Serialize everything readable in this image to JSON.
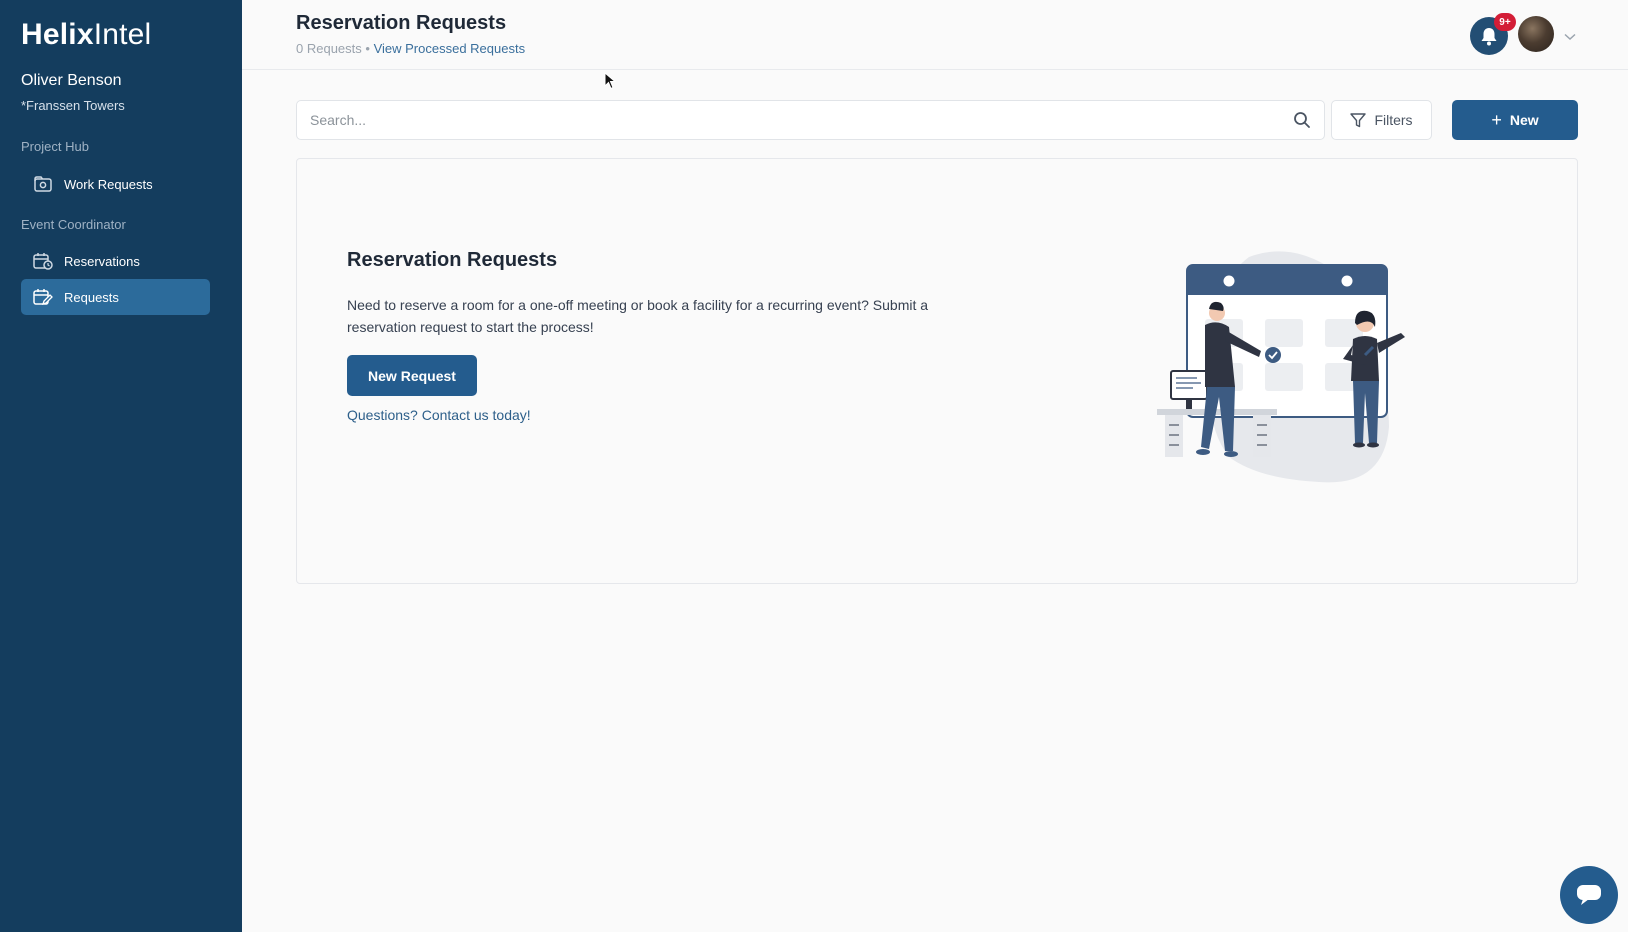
{
  "brand": {
    "bold": "Helix",
    "light": "Intel"
  },
  "user": {
    "name": "Oliver Benson",
    "org": "*Franssen Towers"
  },
  "sidebar": {
    "sections": [
      {
        "label": "Project Hub",
        "items": [
          {
            "label": "Work Requests",
            "icon": "folder-camera-icon",
            "active": false
          }
        ]
      },
      {
        "label": "Event Coordinator",
        "items": [
          {
            "label": "Reservations",
            "icon": "calendar-clock-icon",
            "active": false
          },
          {
            "label": "Requests",
            "icon": "calendar-edit-icon",
            "active": true
          }
        ]
      }
    ]
  },
  "header": {
    "title": "Reservation Requests",
    "count": "0 Requests",
    "separator": "•",
    "processed_link": "View Processed Requests",
    "notification_badge": "9+"
  },
  "toolbar": {
    "search_placeholder": "Search...",
    "filters_label": "Filters",
    "new_label": "New"
  },
  "empty_state": {
    "title": "Reservation Requests",
    "description": "Need to reserve a room for a one-off meeting or book a facility for a recurring event? Submit a reservation request to start the process!",
    "button_label": "New Request",
    "contact_link": "Questions? Contact us today!"
  },
  "colors": {
    "sidebar_bg": "#143d5e",
    "accent": "#245c8e",
    "active_nav": "#2c6b9b",
    "badge": "#d31d36",
    "illustration_primary": "#3d5b82"
  }
}
